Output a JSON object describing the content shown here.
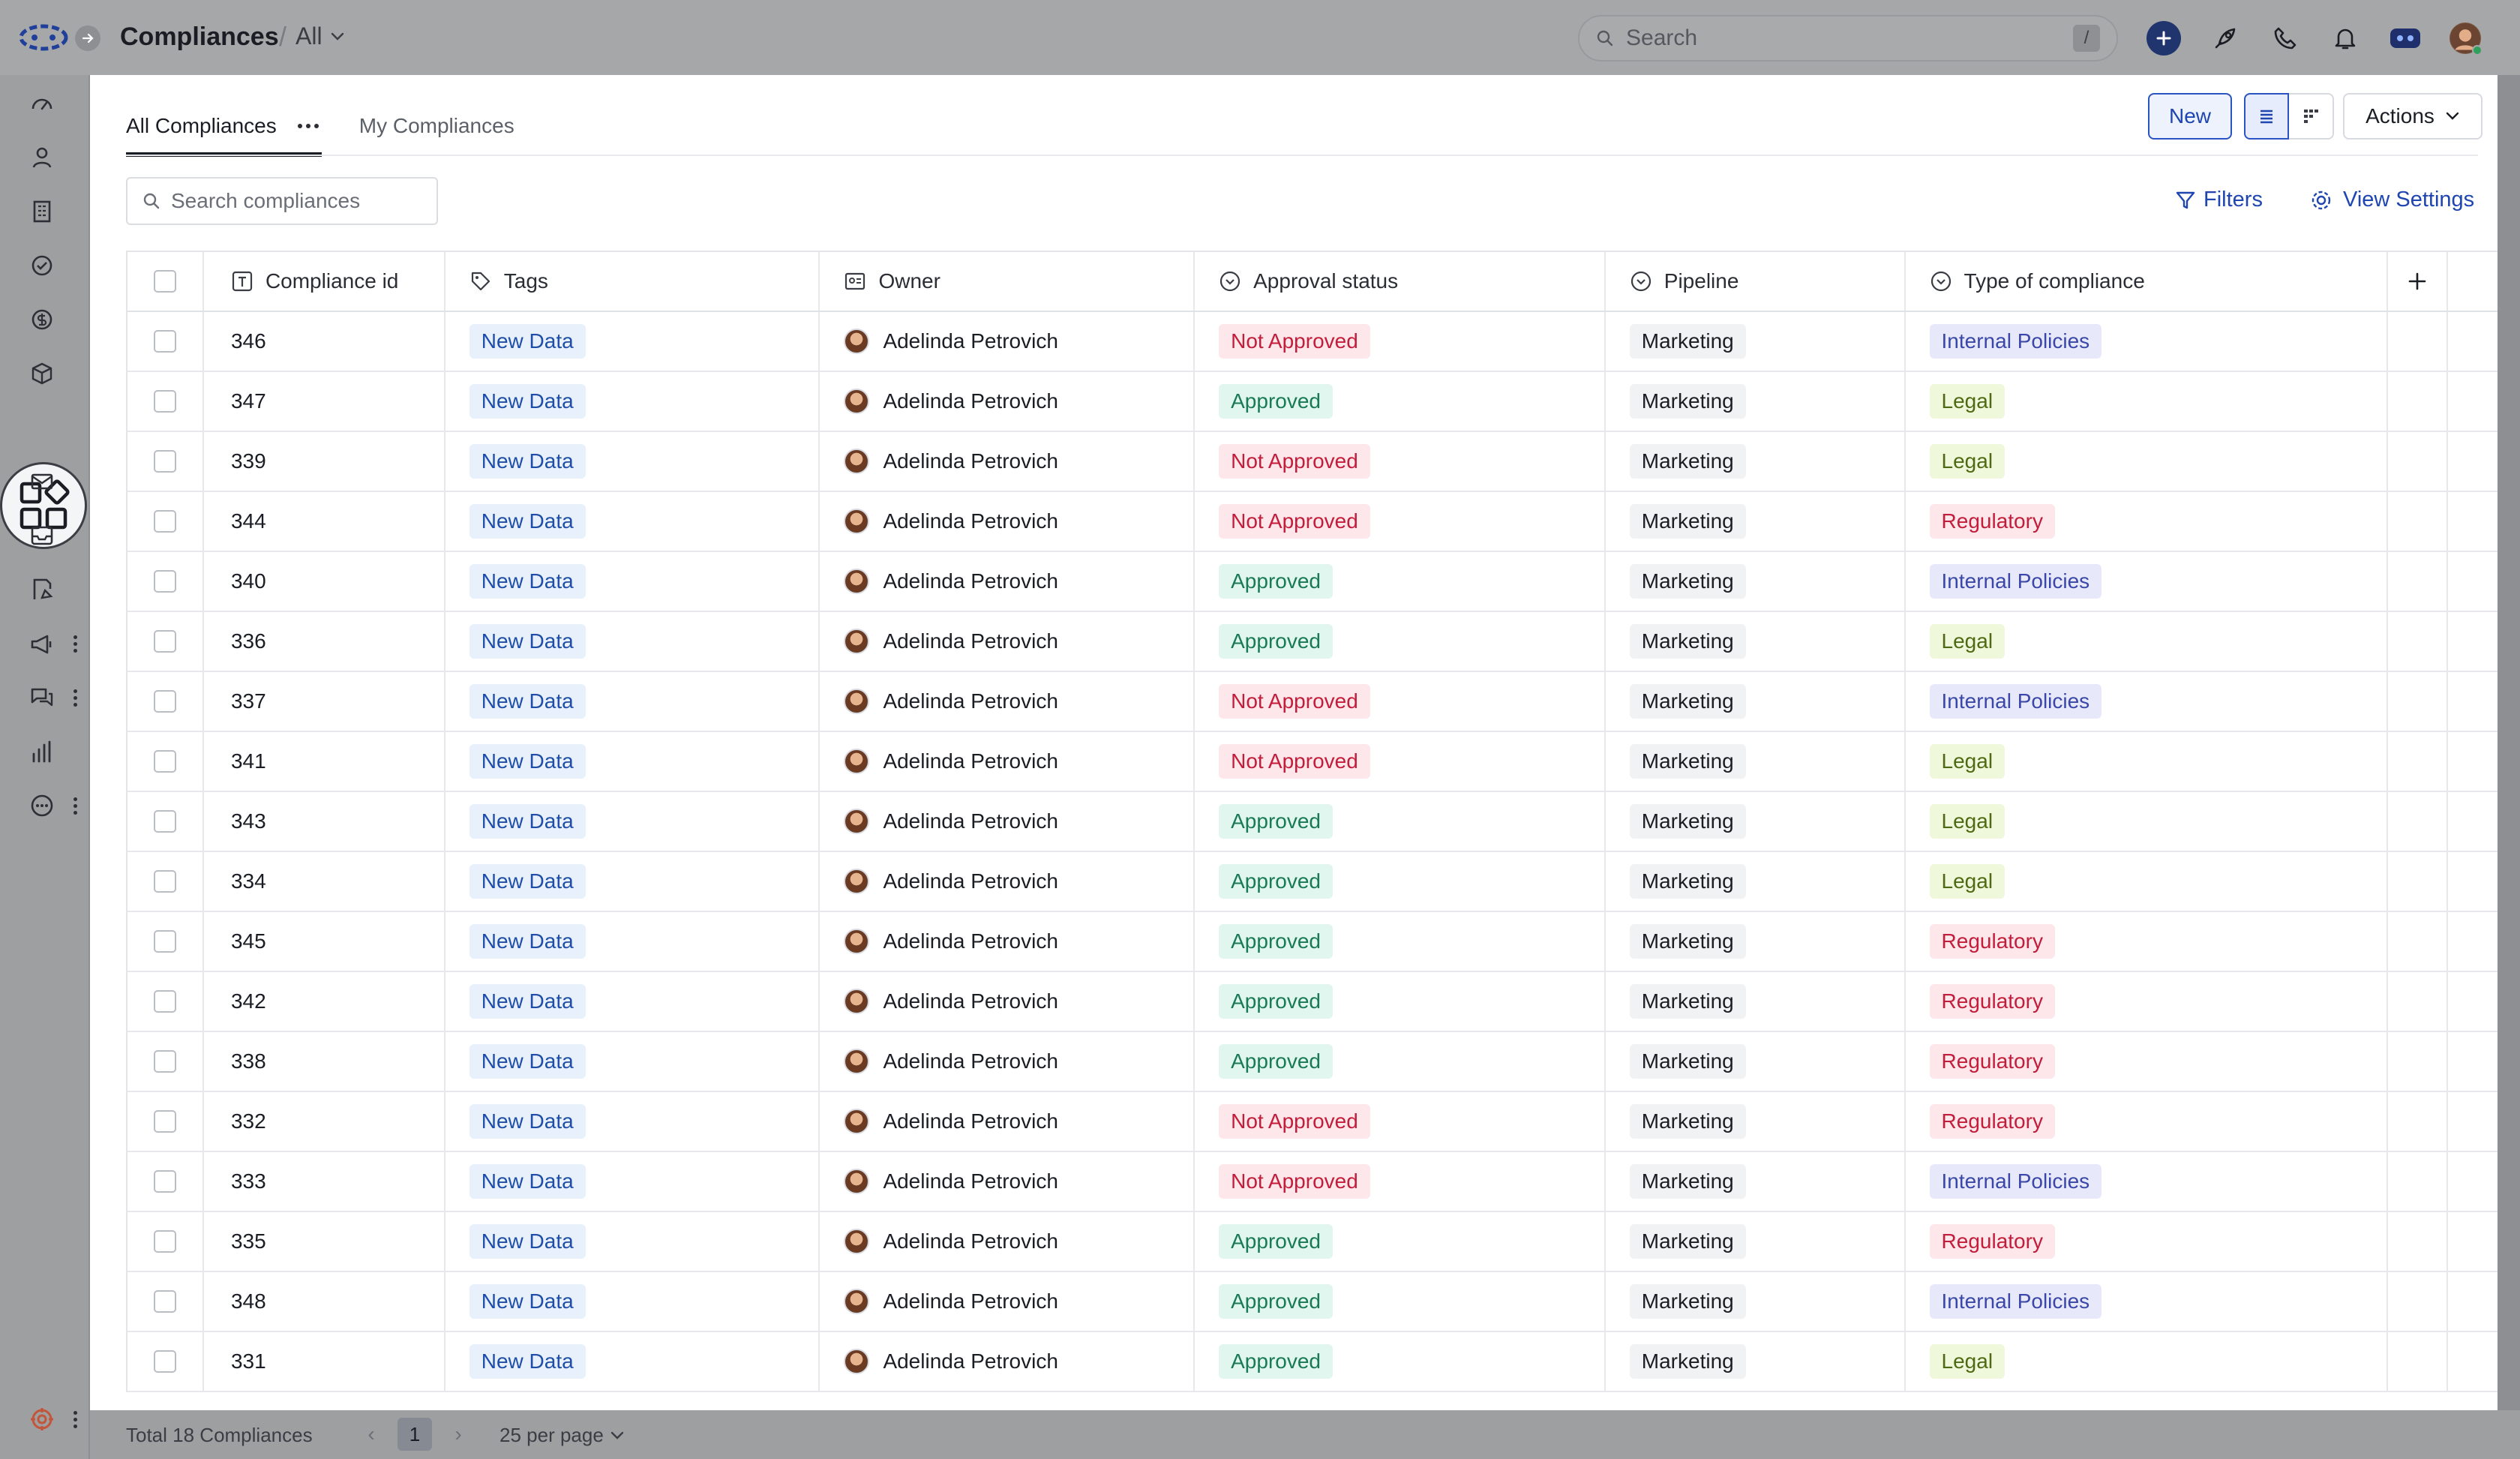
{
  "header": {
    "title": "Compliances",
    "view": "All",
    "search_placeholder": "Search",
    "search_shortcut": "/"
  },
  "icons": {
    "logo": "app-logo-icon",
    "quick_add": "plus-icon",
    "rocket": "rocket-icon",
    "phone": "phone-icon",
    "bell": "bell-icon",
    "assistant": "assistant-icon",
    "user": "avatar"
  },
  "sidebar": {
    "items": [
      "dashboard-icon",
      "contacts-icon",
      "companies-icon",
      "tasks-icon",
      "deals-icon",
      "products-icon",
      "apps-icon",
      "email-icon",
      "inbox-icon",
      "documents-icon",
      "campaigns-icon",
      "chat-icon",
      "reports-icon",
      "more-icon",
      "settings-icon"
    ]
  },
  "tabs": {
    "all": "All Compliances",
    "mine": "My Compliances"
  },
  "toolbar": {
    "new_label": "New",
    "actions_label": "Actions",
    "search_placeholder": "Search compliances",
    "filters_label": "Filters",
    "view_settings_label": "View Settings"
  },
  "table": {
    "columns": {
      "id": "Compliance id",
      "tags": "Tags",
      "owner": "Owner",
      "approval": "Approval status",
      "pipeline": "Pipeline",
      "type": "Type of compliance"
    },
    "rows": [
      {
        "id": "346",
        "tag": "New Data",
        "owner": "Adelinda Petrovich",
        "approval": "Not Approved",
        "pipeline": "Marketing",
        "type": "Internal Policies"
      },
      {
        "id": "347",
        "tag": "New Data",
        "owner": "Adelinda Petrovich",
        "approval": "Approved",
        "pipeline": "Marketing",
        "type": "Legal"
      },
      {
        "id": "339",
        "tag": "New Data",
        "owner": "Adelinda Petrovich",
        "approval": "Not Approved",
        "pipeline": "Marketing",
        "type": "Legal"
      },
      {
        "id": "344",
        "tag": "New Data",
        "owner": "Adelinda Petrovich",
        "approval": "Not Approved",
        "pipeline": "Marketing",
        "type": "Regulatory"
      },
      {
        "id": "340",
        "tag": "New Data",
        "owner": "Adelinda Petrovich",
        "approval": "Approved",
        "pipeline": "Marketing",
        "type": "Internal Policies"
      },
      {
        "id": "336",
        "tag": "New Data",
        "owner": "Adelinda Petrovich",
        "approval": "Approved",
        "pipeline": "Marketing",
        "type": "Legal"
      },
      {
        "id": "337",
        "tag": "New Data",
        "owner": "Adelinda Petrovich",
        "approval": "Not Approved",
        "pipeline": "Marketing",
        "type": "Internal Policies"
      },
      {
        "id": "341",
        "tag": "New Data",
        "owner": "Adelinda Petrovich",
        "approval": "Not Approved",
        "pipeline": "Marketing",
        "type": "Legal"
      },
      {
        "id": "343",
        "tag": "New Data",
        "owner": "Adelinda Petrovich",
        "approval": "Approved",
        "pipeline": "Marketing",
        "type": "Legal"
      },
      {
        "id": "334",
        "tag": "New Data",
        "owner": "Adelinda Petrovich",
        "approval": "Approved",
        "pipeline": "Marketing",
        "type": "Legal"
      },
      {
        "id": "345",
        "tag": "New Data",
        "owner": "Adelinda Petrovich",
        "approval": "Approved",
        "pipeline": "Marketing",
        "type": "Regulatory"
      },
      {
        "id": "342",
        "tag": "New Data",
        "owner": "Adelinda Petrovich",
        "approval": "Approved",
        "pipeline": "Marketing",
        "type": "Regulatory"
      },
      {
        "id": "338",
        "tag": "New Data",
        "owner": "Adelinda Petrovich",
        "approval": "Approved",
        "pipeline": "Marketing",
        "type": "Regulatory"
      },
      {
        "id": "332",
        "tag": "New Data",
        "owner": "Adelinda Petrovich",
        "approval": "Not Approved",
        "pipeline": "Marketing",
        "type": "Regulatory"
      },
      {
        "id": "333",
        "tag": "New Data",
        "owner": "Adelinda Petrovich",
        "approval": "Not Approved",
        "pipeline": "Marketing",
        "type": "Internal Policies"
      },
      {
        "id": "335",
        "tag": "New Data",
        "owner": "Adelinda Petrovich",
        "approval": "Approved",
        "pipeline": "Marketing",
        "type": "Regulatory"
      },
      {
        "id": "348",
        "tag": "New Data",
        "owner": "Adelinda Petrovich",
        "approval": "Approved",
        "pipeline": "Marketing",
        "type": "Internal Policies"
      },
      {
        "id": "331",
        "tag": "New Data",
        "owner": "Adelinda Petrovich",
        "approval": "Approved",
        "pipeline": "Marketing",
        "type": "Legal"
      }
    ]
  },
  "footer": {
    "total": "Total 18 Compliances",
    "page": "1",
    "per_page": "25 per page"
  },
  "colors": {
    "accent": "#1f45b0",
    "approved": "#197a55",
    "not_approved": "#c21d3a"
  }
}
